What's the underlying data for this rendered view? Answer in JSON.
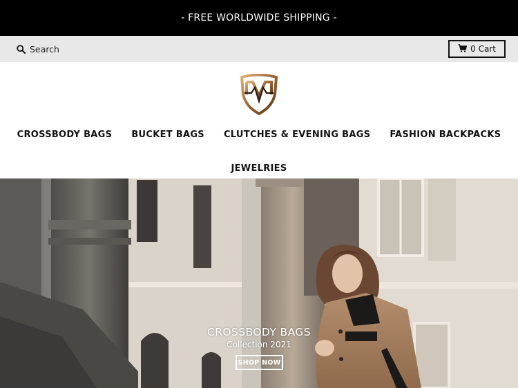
{
  "announcement": {
    "text": "- FREE WORLDWIDE SHIPPING -"
  },
  "utility_bar": {
    "search_label": "Search",
    "cart_label": "0 Cart"
  },
  "nav": {
    "items": [
      {
        "label": "CROSSBODY BAGS"
      },
      {
        "label": "BUCKET BAGS"
      },
      {
        "label": "CLUTCHES & EVENING BAGS"
      },
      {
        "label": "FASHION BACKPACKS"
      },
      {
        "label": "JEWELRIES"
      }
    ]
  },
  "hero": {
    "title": "CROSSBODY BAGS",
    "subtitle": "Collection 2021",
    "cta_label": "SHOP NOW"
  },
  "colors": {
    "announcement_bg": "#000000",
    "utility_bg": "#e8e8e8",
    "logo_gold": "#b07a45",
    "text": "#111111"
  },
  "icons": {
    "search": "search-icon",
    "cart": "cart-icon",
    "logo": "brand-shield-logo"
  }
}
